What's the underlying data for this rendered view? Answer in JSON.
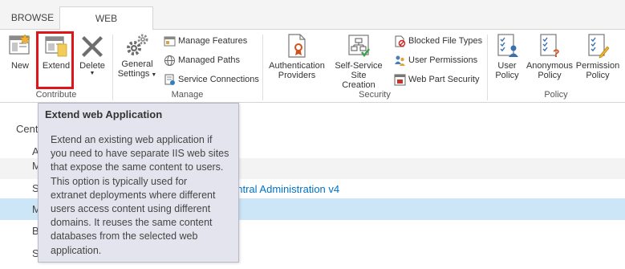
{
  "tabs": [
    {
      "label": "BROWSE"
    },
    {
      "label": "WEB APPLICATIONS"
    }
  ],
  "ribbon": {
    "contribute": {
      "label": "Contribute",
      "new_label": "New",
      "extend_label": "Extend",
      "delete_label": "Delete"
    },
    "manage": {
      "label": "Manage",
      "general_settings_line1": "General",
      "general_settings_line2": "Settings",
      "manage_features": "Manage Features",
      "managed_paths": "Managed Paths",
      "service_connections": "Service Connections"
    },
    "security": {
      "label": "Security",
      "auth_providers_line1": "Authentication",
      "auth_providers_line2": "Providers",
      "self_service_line1": "Self-Service Site",
      "self_service_line2": "Creation",
      "blocked_file_types": "Blocked File Types",
      "user_permissions": "User Permissions",
      "web_part_security": "Web Part Security"
    },
    "policy": {
      "label": "Policy",
      "user_policy_line1": "User",
      "user_policy_line2": "Policy",
      "anonymous_policy_line1": "Anonymous",
      "anonymous_policy_line2": "Policy",
      "permission_policy_line1": "Permission",
      "permission_policy_line2": "Policy"
    }
  },
  "content": {
    "heading_fragment": "Centr",
    "row_a_fragment": "A",
    "row_m_fragment": "M",
    "row_s_fragment": "S",
    "row_m2_fragment": "M",
    "row_b_fragment": "B",
    "row_s2_fragment": "S",
    "central_admin_link": "entral Administration v4"
  },
  "tooltip": {
    "title": "Extend web Application",
    "body_lines": [
      "Extend an existing web application if",
      "you need to have separate IIS web sites",
      "that expose the same content to users.",
      "This option is typically used for",
      "extranet deployments where different",
      "users access content using different",
      "domains. It reuses the same content",
      "databases from the selected web",
      "application."
    ]
  },
  "colors": {
    "highlight_border": "#e0141b",
    "link": "#0072c6",
    "selected_row": "#cde6f7",
    "tooltip_bg": "#e4e4ee"
  }
}
